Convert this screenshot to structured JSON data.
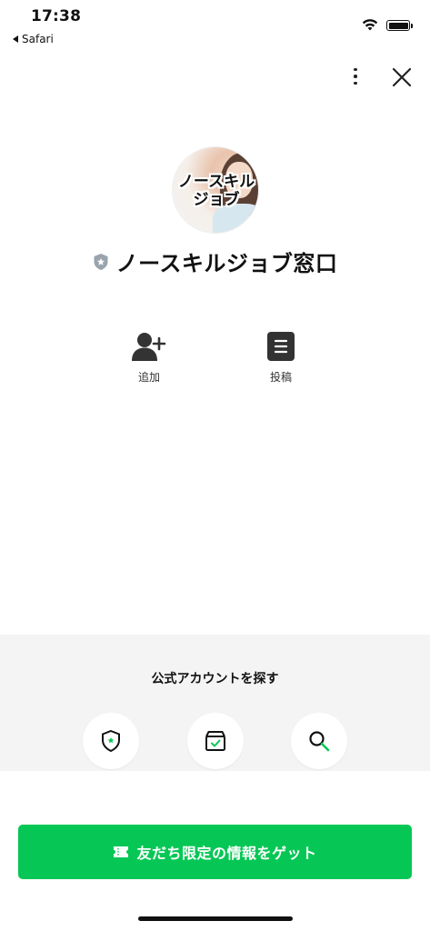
{
  "status_bar": {
    "time": "17:38",
    "back_app": "Safari"
  },
  "header": {
    "more_icon": "more-vertical-icon",
    "close_icon": "close-icon"
  },
  "profile": {
    "avatar_text": "ノースキルジョブ",
    "name": "ノースキルジョブ窓口",
    "badge_icon": "verified-shield-icon"
  },
  "actions": [
    {
      "label": "追加",
      "icon": "add-friend-icon"
    },
    {
      "label": "投稿",
      "icon": "posts-icon"
    }
  ],
  "explore": {
    "title": "公式アカウントを探す",
    "buttons": [
      {
        "icon": "official-badge-icon"
      },
      {
        "icon": "box-check-icon"
      },
      {
        "icon": "search-icon"
      }
    ]
  },
  "cta": {
    "label": "友だち限定の情報をゲット",
    "icon": "ticket-icon"
  },
  "colors": {
    "accent": "#06c755",
    "section_bg": "#f4f4f4"
  }
}
